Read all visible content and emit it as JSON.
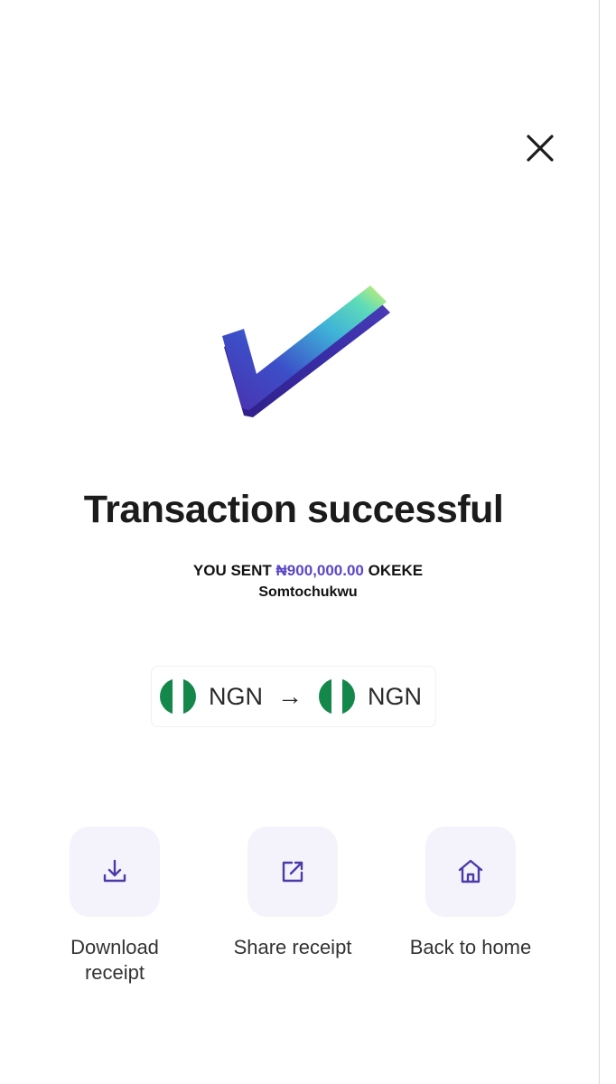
{
  "header": {
    "close_icon": "close-icon"
  },
  "hero": {
    "icon": "checkmark-3d-icon",
    "gradient_colors": [
      "#4b2fae",
      "#3d68d8",
      "#3fd0c9",
      "#d8f06a"
    ]
  },
  "status": {
    "title": "Transaction successful",
    "sent_prefix": "YOU SENT",
    "amount": "₦900,000.00",
    "recipient_last": "OKEKE",
    "recipient_first": "Somtochukwu",
    "accent_color": "#5b47c6"
  },
  "currency_pair": {
    "from_code": "NGN",
    "to_code": "NGN",
    "arrow": "→",
    "flag_colors": [
      "#14884a",
      "#ffffff"
    ]
  },
  "actions": [
    {
      "label": "Download receipt",
      "icon": "download-icon"
    },
    {
      "label": "Share receipt",
      "icon": "share-icon"
    },
    {
      "label": "Back to home",
      "icon": "home-icon"
    }
  ]
}
